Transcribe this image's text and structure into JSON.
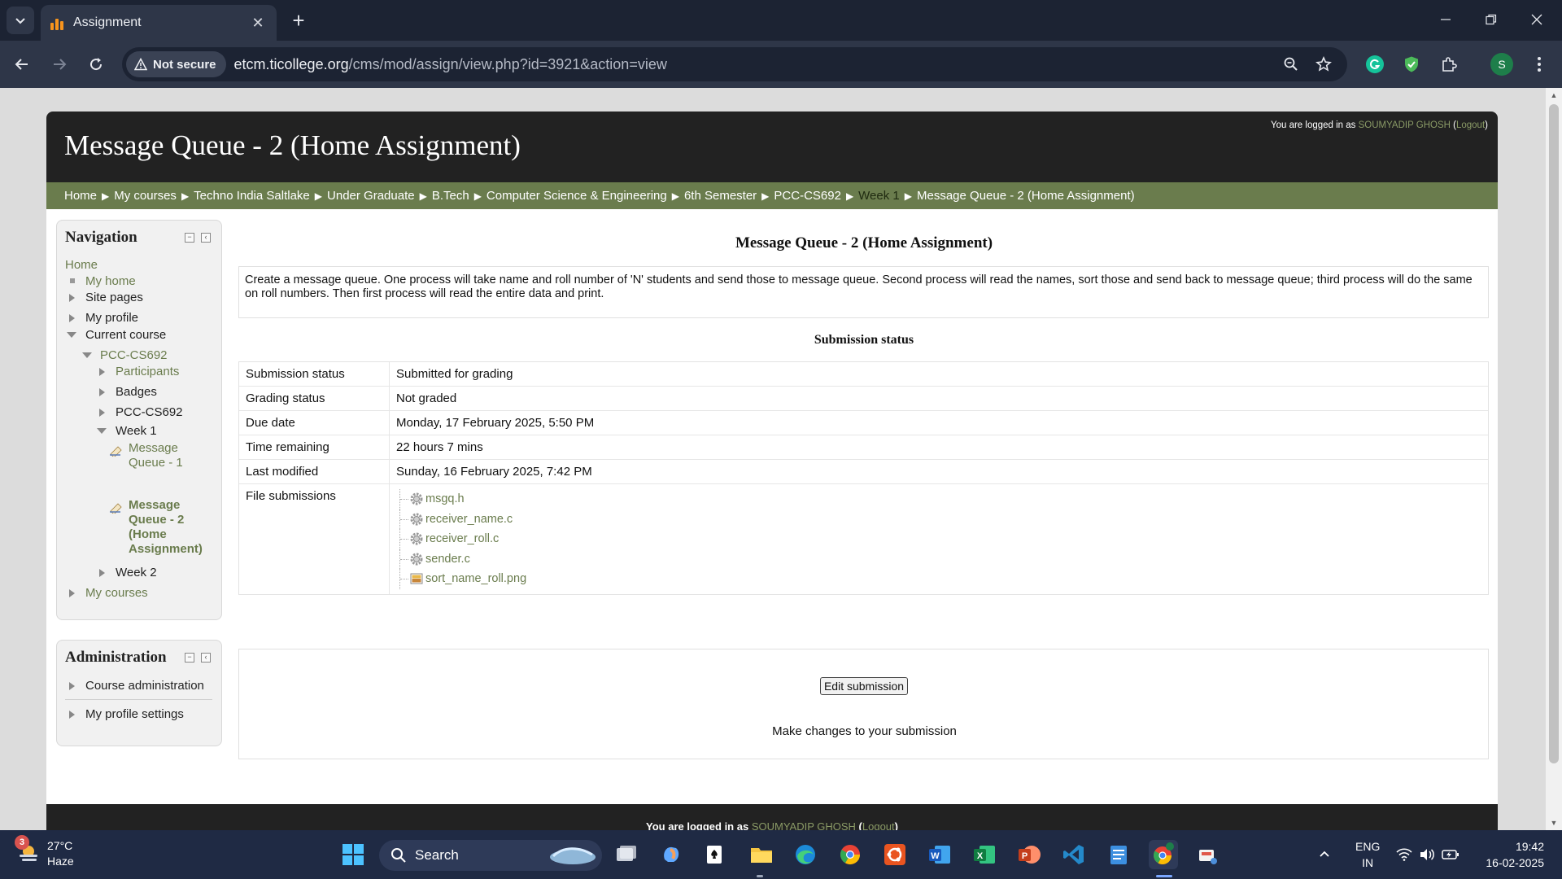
{
  "browser": {
    "tab_title": "Assignment",
    "security_label": "Not secure",
    "url_host": "etcm.ticollege.org",
    "url_path": "/cms/mod/assign/view.php?id=3921&action=view",
    "profile_initial": "S"
  },
  "header": {
    "site_title": "Message Queue - 2 (Home Assignment)",
    "login_prefix": "You are logged in as ",
    "user_name": "SOUMYADIP GHOSH",
    "logout_label": "Logout"
  },
  "breadcrumb": [
    "Home",
    "My courses",
    "Techno India Saltlake",
    "Under Graduate",
    "B.Tech",
    "Computer Science & Engineering",
    "6th Semester",
    "PCC-CS692",
    "Week 1",
    "Message Queue - 2 (Home Assignment)"
  ],
  "navigation": {
    "title": "Navigation",
    "home": "Home",
    "my_home": "My home",
    "site_pages": "Site pages",
    "my_profile": "My profile",
    "current_course": "Current course",
    "course_code": "PCC-CS692",
    "participants": "Participants",
    "badges": "Badges",
    "course_section": "PCC-CS692",
    "week1": "Week 1",
    "activity1": "Message Queue - 1",
    "activity2": "Message Queue - 2 (Home Assignment)",
    "week2": "Week 2",
    "my_courses": "My courses"
  },
  "administration": {
    "title": "Administration",
    "course_admin": "Course administration",
    "profile_settings": "My profile settings"
  },
  "main": {
    "title": "Message Queue - 2 (Home Assignment)",
    "intro": "Create a message queue. One process will take name and roll number of 'N' students and send those to message queue. Second process will read the names, sort those and send back to message queue; third process will do the same on roll numbers. Then first process will read the entire data and print.",
    "section_title": "Submission status",
    "status_rows": [
      {
        "label": "Submission status",
        "value": "Submitted for grading"
      },
      {
        "label": "Grading status",
        "value": "Not graded"
      },
      {
        "label": "Due date",
        "value": "Monday, 17 February 2025, 5:50 PM"
      },
      {
        "label": "Time remaining",
        "value": "22 hours 7 mins"
      },
      {
        "label": "Last modified",
        "value": "Sunday, 16 February 2025, 7:42 PM"
      }
    ],
    "file_submissions_label": "File submissions",
    "files": [
      {
        "name": "msgq.h",
        "icon": "gear-file-icon"
      },
      {
        "name": "receiver_name.c",
        "icon": "gear-file-icon"
      },
      {
        "name": "receiver_roll.c",
        "icon": "gear-file-icon"
      },
      {
        "name": "sender.c",
        "icon": "gear-file-icon"
      },
      {
        "name": "sort_name_roll.png",
        "icon": "image-file-icon"
      }
    ],
    "edit_button": "Edit submission",
    "edit_note": "Make changes to your submission"
  },
  "footer": {
    "login_prefix": "You are logged in as ",
    "user_name": "SOUMYADIP GHOSH",
    "logout_label": "Logout"
  },
  "taskbar": {
    "weather_badge": "3",
    "temperature": "27°C",
    "condition": "Haze",
    "search_label": "Search",
    "language": "ENG",
    "region": "IN",
    "time": "19:42",
    "date": "16-02-2025"
  },
  "colors": {
    "moodle_green": "#6a7c4d",
    "header_dark": "#222222",
    "browser_dark": "#1c2333",
    "taskbar": "#1f2a44"
  }
}
